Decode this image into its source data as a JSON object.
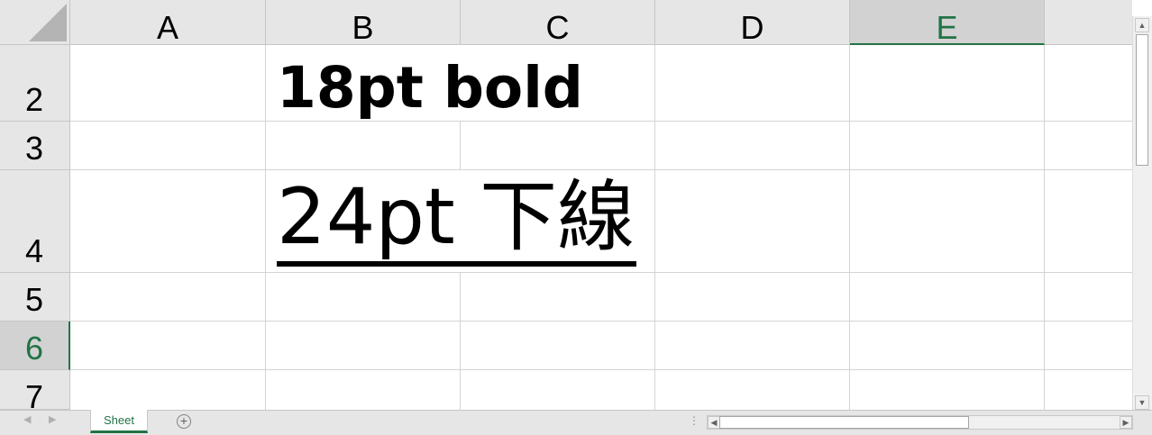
{
  "columns": [
    {
      "label": "A"
    },
    {
      "label": "B"
    },
    {
      "label": "C"
    },
    {
      "label": "D"
    },
    {
      "label": "E"
    }
  ],
  "rows": [
    {
      "label": "2"
    },
    {
      "label": "3"
    },
    {
      "label": "4"
    },
    {
      "label": "5"
    },
    {
      "label": "6"
    },
    {
      "label": "7"
    }
  ],
  "selection": {
    "column": "E",
    "row": "6"
  },
  "cells": {
    "B2": "18pt bold",
    "B4": "24pt 下線"
  },
  "sheet_tabs": [
    {
      "label": "Sheet",
      "active": true
    }
  ],
  "icons": {
    "add_sheet": "plus-circle-icon",
    "scroll_left": "triangle-left-icon",
    "scroll_right": "triangle-right-icon",
    "scroll_up": "triangle-up-icon",
    "scroll_down": "triangle-down-icon",
    "split": "vertical-dots-icon"
  },
  "colors": {
    "accent": "#217346",
    "header_bg": "#e6e6e6",
    "header_selected_bg": "#d2d2d2",
    "gridline": "#d4d4d4"
  }
}
